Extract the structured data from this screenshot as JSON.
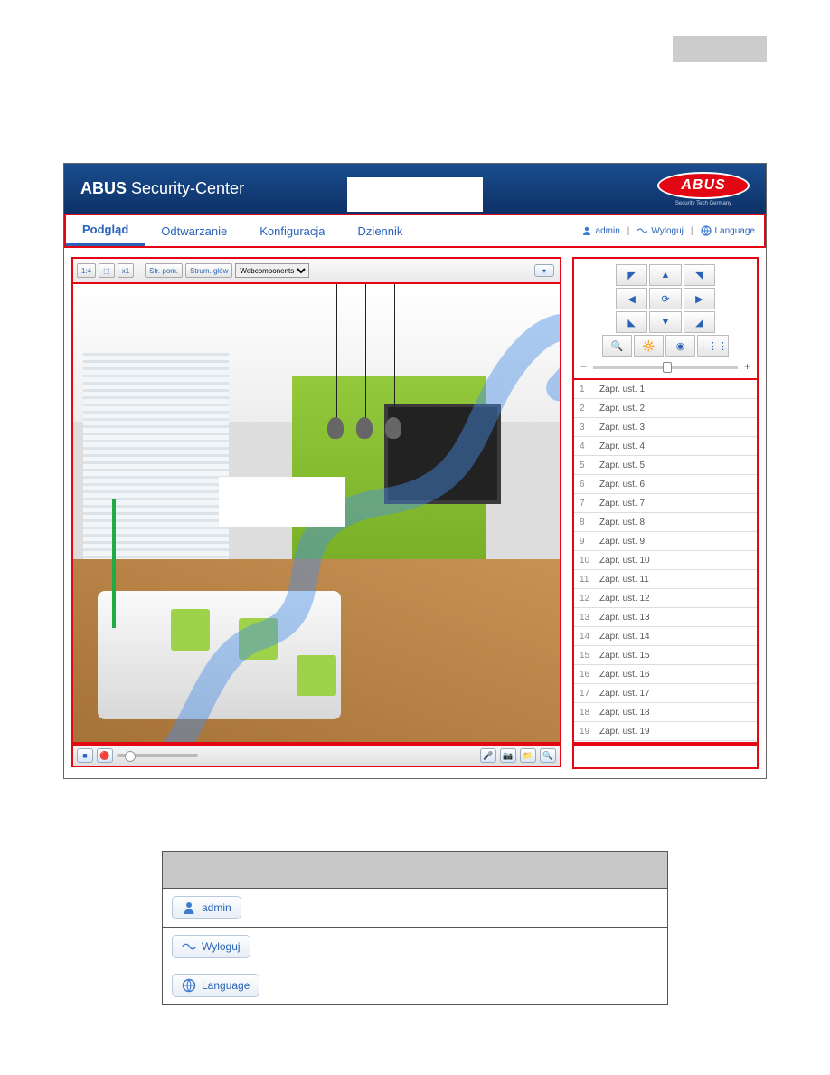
{
  "header": {
    "brand_bold": "ABUS",
    "brand_rest": " Security-Center",
    "logo_text": "ABUS",
    "logo_tagline": "Security Tech Germany"
  },
  "nav": {
    "tabs": [
      "Podgląd",
      "Odtwarzanie",
      "Konfiguracja",
      "Dziennik"
    ],
    "active_tab": "Podgląd",
    "user": "admin",
    "logout": "Wyloguj",
    "language": "Language"
  },
  "video_toolbar": {
    "buttons": [
      "1:4",
      "⬚",
      "x1"
    ],
    "str_pom": "Str. pom.",
    "strum_glow": "Strum. głów",
    "select_value": "Webcomponents"
  },
  "ptz": {
    "cells": [
      "◤",
      "▲",
      "◥",
      "◀",
      "⟳",
      "▶",
      "◣",
      "▼",
      "◢"
    ],
    "extra": [
      "🔍",
      "🔆",
      "◉",
      "⋮⋮⋮"
    ]
  },
  "presets": [
    {
      "num": "1",
      "label": "Zapr. ust. 1"
    },
    {
      "num": "2",
      "label": "Zapr. ust. 2"
    },
    {
      "num": "3",
      "label": "Zapr. ust. 3"
    },
    {
      "num": "4",
      "label": "Zapr. ust. 4"
    },
    {
      "num": "5",
      "label": "Zapr. ust. 5"
    },
    {
      "num": "6",
      "label": "Zapr. ust. 6"
    },
    {
      "num": "7",
      "label": "Zapr. ust. 7"
    },
    {
      "num": "8",
      "label": "Zapr. ust. 8"
    },
    {
      "num": "9",
      "label": "Zapr. ust. 9"
    },
    {
      "num": "10",
      "label": "Zapr. ust. 10"
    },
    {
      "num": "11",
      "label": "Zapr. ust. 11"
    },
    {
      "num": "12",
      "label": "Zapr. ust. 12"
    },
    {
      "num": "13",
      "label": "Zapr. ust. 13"
    },
    {
      "num": "14",
      "label": "Zapr. ust. 14"
    },
    {
      "num": "15",
      "label": "Zapr. ust. 15"
    },
    {
      "num": "16",
      "label": "Zapr. ust. 16"
    },
    {
      "num": "17",
      "label": "Zapr. ust. 17"
    },
    {
      "num": "18",
      "label": "Zapr. ust. 18"
    },
    {
      "num": "19",
      "label": "Zapr. ust. 19"
    }
  ],
  "bottom_bar": {
    "left_icons": [
      "■",
      "🔴"
    ],
    "right_icons": [
      "🎤",
      "📷",
      "📁",
      "🔍"
    ]
  },
  "table": {
    "rows": [
      {
        "label": "admin"
      },
      {
        "label": "Wyloguj"
      },
      {
        "label": "Language"
      }
    ]
  }
}
